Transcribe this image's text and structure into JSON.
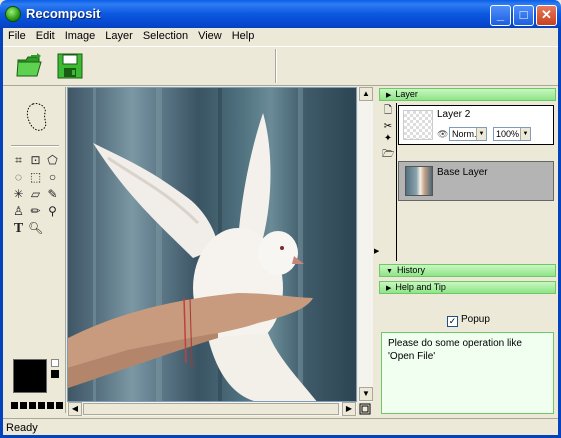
{
  "window": {
    "title": "Recomposit"
  },
  "menu": [
    "File",
    "Edit",
    "Image",
    "Layer",
    "Selection",
    "View",
    "Help"
  ],
  "toolbar": {
    "open_icon": "open-folder-icon",
    "save_icon": "save-disk-icon"
  },
  "layers_panel": {
    "header": "Layer",
    "layers": [
      {
        "name": "Layer 2",
        "blend_mode": "Norm.",
        "opacity": "100%"
      },
      {
        "name": "Base Layer"
      }
    ]
  },
  "history_panel": {
    "header": "History"
  },
  "help_panel": {
    "header": "Help and Tip",
    "popup_label": "Popup",
    "popup_checked": true,
    "tip": "Please do some operation like 'Open File'"
  },
  "status": {
    "text": "Ready"
  },
  "colors": {
    "title_blue": "#0b58e0",
    "panel_green": "#8ee587",
    "tip_bg": "#f0fff0"
  }
}
